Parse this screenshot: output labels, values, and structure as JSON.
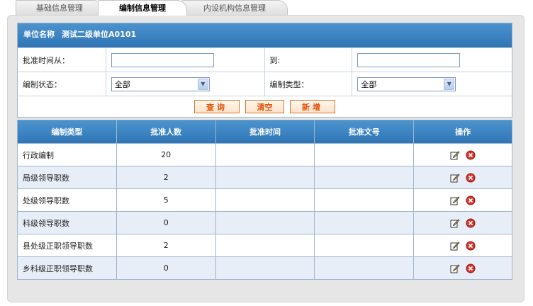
{
  "tabs": [
    {
      "label": "基础信息管理",
      "active": false
    },
    {
      "label": "编制信息管理",
      "active": true
    },
    {
      "label": "内设机构信息管理",
      "active": false
    }
  ],
  "unit": {
    "label": "单位名称",
    "value": "测试二级单位A0101"
  },
  "form": {
    "approve_from_label": "批准时间从：",
    "approve_from_value": "",
    "approve_to_label": "到:",
    "approve_to_value": "",
    "status_label": "编制状态：",
    "status_value": "全部",
    "type_label": "编制类型：",
    "type_value": "全部"
  },
  "buttons": {
    "query": "查询",
    "clear": "清空",
    "add": "新增"
  },
  "table": {
    "headers": [
      "编制类型",
      "批准人数",
      "批准时间",
      "批准文号",
      "操作"
    ],
    "rows": [
      {
        "type": "行政编制",
        "count": "20",
        "time": "",
        "doc": ""
      },
      {
        "type": "局级领导职数",
        "count": "2",
        "time": "",
        "doc": ""
      },
      {
        "type": "处级领导职数",
        "count": "5",
        "time": "",
        "doc": ""
      },
      {
        "type": "科级领导职数",
        "count": "0",
        "time": "",
        "doc": ""
      },
      {
        "type": "县处级正职领导职数",
        "count": "2",
        "time": "",
        "doc": ""
      },
      {
        "type": "乡科级正职领导职数",
        "count": "0",
        "time": "",
        "doc": ""
      }
    ]
  },
  "icons": {
    "edit": "edit-icon",
    "delete": "delete-icon"
  },
  "colors": {
    "header_blue": "#3a82c3",
    "row_alt": "#e8eef8",
    "button_text": "#e4520a",
    "panel_bg": "#e6e6e6"
  }
}
